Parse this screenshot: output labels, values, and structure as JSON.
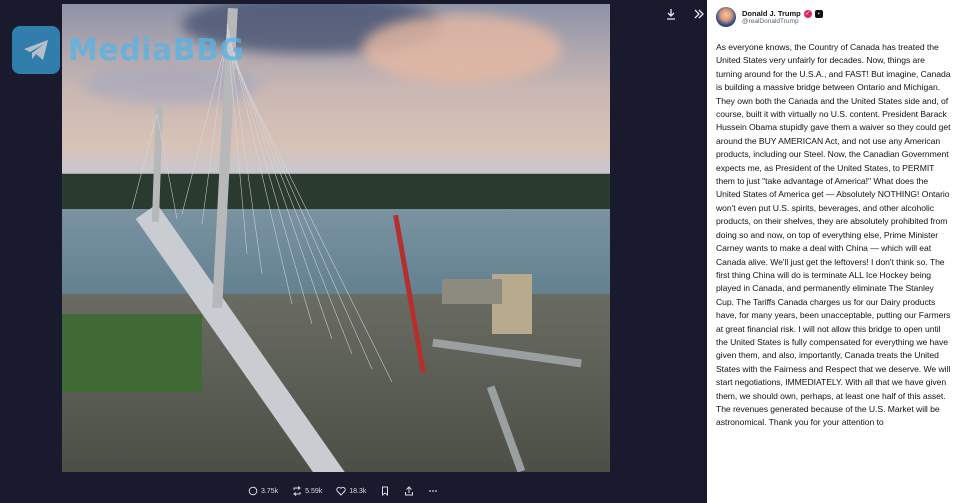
{
  "watermark": {
    "text": "MediaBBG"
  },
  "viewer": {
    "download_icon": "download-icon",
    "expand_icon": "expand-panel-icon"
  },
  "actions": {
    "replies": "3.75k",
    "reposts": "5.59k",
    "likes": "18.3k"
  },
  "post": {
    "display_name": "Donald J. Trump",
    "handle": "@realDonaldTrump",
    "text": "As everyone knows, the Country of Canada has treated the United States very unfairly for decades. Now, things are turning around for the U.S.A., and FAST! But imagine, Canada is building a massive bridge between Ontario and Michigan. They own both the Canada and the United States side and, of course, built it with virtually no U.S. content. President Barack Hussein Obama stupidly gave them a waiver so they could get around the BUY AMERICAN Act, and not use any American products, including our Steel. Now, the Canadian Government expects me, as President of the United States, to PERMIT them to just \"take advantage of America!\" What does the United States of America get — Absolutely NOTHING! Ontario won't even put U.S. spirits, beverages, and other alcoholic products, on their shelves, they are absolutely prohibited from doing so and now, on top of everything else, Prime Minister Carney wants to make a deal with China — which will eat Canada alive. We'll just get the leftovers! I don't think so. The first thing China will do is terminate ALL Ice Hockey being played in Canada, and permanently eliminate The Stanley Cup. The Tariffs Canada charges us for our Dairy products have, for many years, been unacceptable, putting our Farmers at great financial risk. I will not allow this bridge to open until the United States is fully compensated for everything we have given them, and also, importantly, Canada treats the United States with the Fairness and Respect that we deserve. We will start negotiations, IMMEDIATELY. With all that we have given them, we should own, perhaps, at least one half of this asset. The revenues generated because of the U.S. Market will be astronomical. Thank you for your attention to"
  },
  "colors": {
    "viewer_bg": "#191a2e",
    "verified": "#e0245e",
    "watermark": "#56b4e6"
  }
}
